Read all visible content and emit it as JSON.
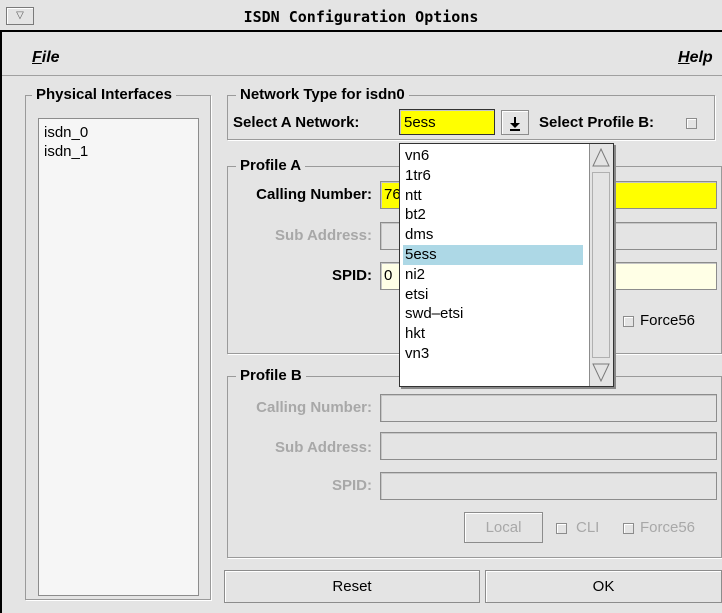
{
  "window": {
    "title": "ISDN Configuration Options",
    "system_menu_glyph": "▽"
  },
  "menubar": {
    "file": "File",
    "file_mnemonic": "F",
    "file_rest": "ile",
    "help": "Help",
    "help_mnemonic": "H",
    "help_rest": "elp"
  },
  "physical_interfaces": {
    "title": "Physical Interfaces",
    "items": [
      "isdn_0",
      "isdn_1"
    ]
  },
  "network_type": {
    "title": "Network Type  for  isdn0",
    "select_label": "Select A Network:",
    "selected_value": "5ess",
    "profile_b_label": "Select Profile B:",
    "profile_b_checked": false
  },
  "profile_a": {
    "title": "Profile A",
    "calling_number_label": "Calling Number:",
    "calling_number_value": "76",
    "sub_address_label": "Sub Address:",
    "spid_label": "SPID:",
    "spid_value": "0",
    "force56_label": "Force56"
  },
  "profile_b": {
    "title": "Profile B",
    "calling_number_label": "Calling Number:",
    "sub_address_label": "Sub Address:",
    "spid_label": "SPID:",
    "local_label": "Local",
    "cli_label": "CLI",
    "force56_label": "Force56"
  },
  "network_dropdown": {
    "options": [
      "vn6",
      "1tr6",
      "ntt",
      "bt2",
      "dms",
      "5ess",
      "ni2",
      "etsi",
      "swd–etsi",
      "hkt",
      "vn3"
    ],
    "selected": "5ess"
  },
  "footer": {
    "reset_label": "Reset",
    "ok_label": "OK"
  },
  "colors": {
    "window_bg": "#e4e4e4",
    "required_field": "#ffff00",
    "optional_field": "#ffffe6",
    "selected_item": "#add8e6"
  }
}
